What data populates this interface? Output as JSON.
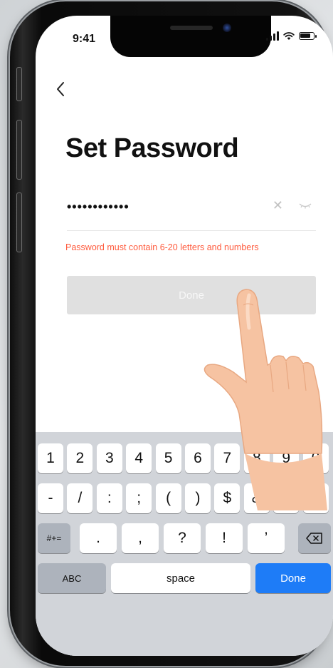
{
  "status_bar": {
    "time": "9:41"
  },
  "nav": {
    "back_icon": "chevron-left-icon"
  },
  "page": {
    "title": "Set Password",
    "password_value": "••••••••••••",
    "clear_icon": "✕",
    "error_text": "Password must contain 6-20 letters and numbers",
    "done_label": "Done"
  },
  "keyboard": {
    "row1": [
      "1",
      "2",
      "3",
      "4",
      "5",
      "6",
      "7",
      "8",
      "9",
      "0"
    ],
    "row2": [
      "-",
      "/",
      ":",
      ";",
      "(",
      ")",
      "$",
      "&",
      "@",
      "”"
    ],
    "row3_mode": "#+=",
    "row3": [
      ".",
      ",",
      "?",
      "!",
      "’"
    ],
    "abc_label": "ABC",
    "space_label": "space",
    "return_label": "Done"
  },
  "colors": {
    "error": "#ff5a3c",
    "done_disabled": "#e0e0e0",
    "return_key": "#1e7cf7",
    "keyboard_bg": "#d1d4d9"
  }
}
